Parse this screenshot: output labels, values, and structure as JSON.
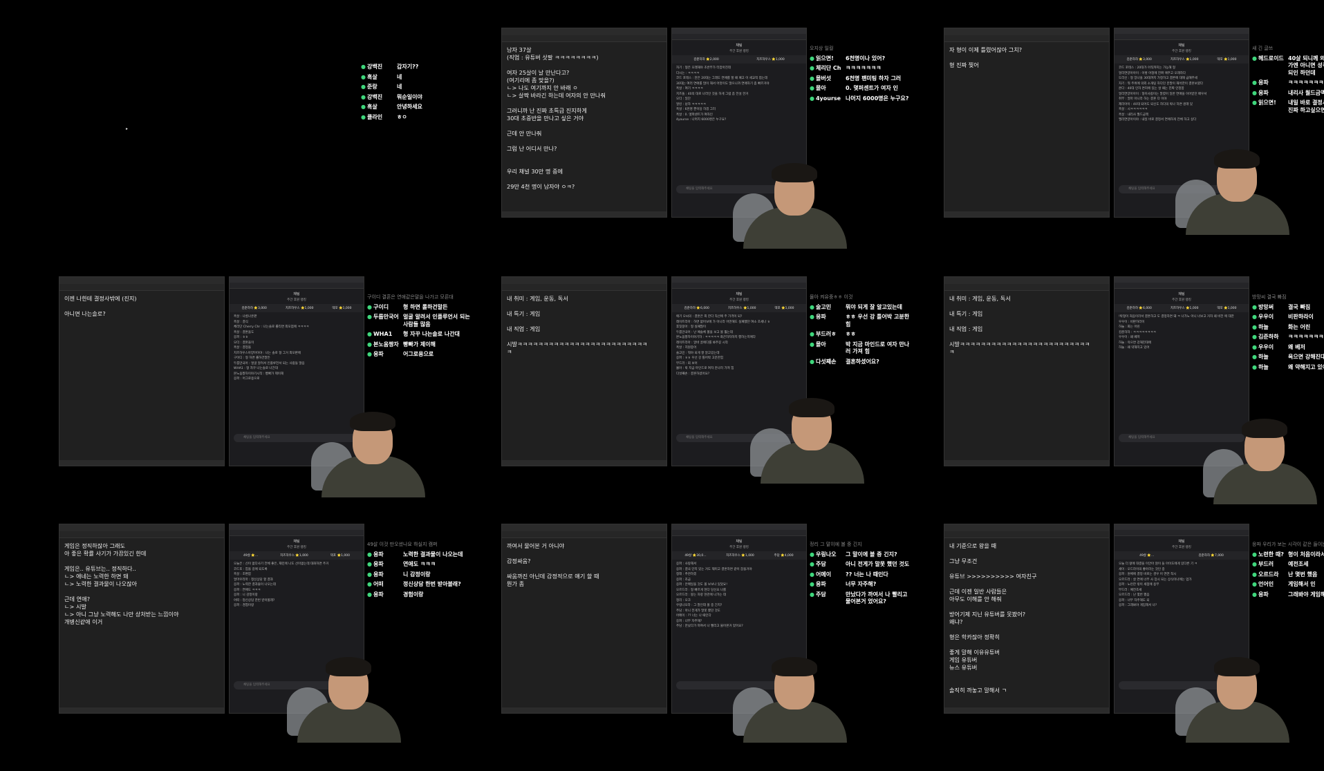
{
  "panels": [
    {
      "blank": true,
      "overlay": {
        "head": "",
        "rows": [
          {
            "name": "강백진",
            "msg": "갑자기??"
          },
          {
            "name": "흑살",
            "msg": "네"
          },
          {
            "name": "준랑",
            "msg": "네"
          },
          {
            "name": "강백진",
            "msg": "뭐순일이야"
          },
          {
            "name": "흑살",
            "msg": "안녕하세요"
          },
          {
            "name": "클라인",
            "msg": "ㅎㅇ"
          }
        ]
      }
    },
    {
      "notepad_text": "남자 37살\n(직업 : 유튜버 삿팔 ㅋㅋㅋㅋㅋㅋㅋㅋ)\n\n여자 25살이 날 만난다고?\n(여기리에 좀 맞을?)\nㄴ> 나도 여기까지 안 바래 ㅇ\nㄴ> 살짝 바라긴 하는데 여자의 안 만나줘\n\n그러니까 난 진짜 초특급 진지하게\n30대 초중반을 만나고 싶은 거야\n\n근데 안 만나줘\n\n그럼 난 어디서 만나?\n\n\n우리 채널 30만 명 중에\n\n29만 4천 명이 남자야 ㅇㅋ?",
      "chat_title": "채팅",
      "chat_sub": "주간 후원 랭킹",
      "donors": [
        "김준하하 ⭐2,000",
        "치즈하우스 ⭐1,000"
      ],
      "chat_lines": [
        "자기 : 형은 오래해야 초반부가 터잡아진데",
        "다시는 : ㅋㅋㅋㅋ",
        "코드 포테스 : 찬은 20대는 그래도 연애를 할 때 패고 이 세교적 접는데",
        "30대는 여러 연애를 많이 해서 어엉이도 많으니까 연애하기 좀 빠르거야",
        "흑살 : 여기 ㅋㅋㅋㅋ",
        "치즈돌 : 40의 대로 나라인 것을 하게 그럼 좀 전설 한거",
        "오더 : 일단",
        "얼린 : 남자 ㅋㅋㅋㅋㅋ",
        "흑살 : 6천명 뿐이당 하겠 그러",
        "흑살 : 0. 엣파센트가 여자인",
        "4yourse : 나머지 6000명은 누구요?"
      ],
      "chat_input": "채팅을 입력해주세요",
      "overlay": {
        "head": "오지상     일컬",
        "rows": [
          {
            "name": "읽으면!",
            "msg": "6천명이나 있어?"
          },
          {
            "name": "체리단 Ch",
            "msg": "ㅋㅋㅋㅋㅋㅋㅋ"
          },
          {
            "name": "몰버섯",
            "msg": "6천명 팬미팅 하자 그러"
          },
          {
            "name": "몰아",
            "msg": "0. 몇퍼센트가 여자 인"
          },
          {
            "name": "4yourse",
            "msg": "나머지 6000명은 누구요?"
          }
        ]
      }
    },
    {
      "notepad_text": "자 형이 이제 틀렸어잖아 그치?\n\n형 진짜 찢어",
      "chat_title": "채팅",
      "chat_sub": "주간 후원 랭킹",
      "donors": [
        "김준하하 ⭐3,000",
        "치즈하우스 ⭐1,000",
        "덱포 ⭐1,000"
      ],
      "chat_lines": [
        "코드 포테스 : 20대가 아직까지는 가능해 형",
        "얼리연양아아이 : 이렇 어정에 진짜 애주고 오래하다",
        "도리신 : 형 장나을 30대까지 가정하고 결론에 대해 급해주세",
        "자기 : 뭐 주위에 의외 소개팅 하다던 분말이 재석한이 결혼보였다",
        "온다 : 40대 인자 면허에 있는 살 때는 진짜 인정함",
        "얼리연양아아이 : 형이사람이는 말렸어 일반 연애을 이어받던 배우서",
        "취부 : 얼마 아니라 하는 결혼 다 이야",
        "제리아이 : 40대 되어도 되신도 하다의 박나 하면 원래 있",
        "흑살 : 시ㅋㅋㅋㅋㅋㅋ",
        "흑살 : 내리사 월드금액",
        "엘리연양아이야 : 내일 바로 결정서 연애하게 전체 하고 싶다"
      ],
      "chat_input": "채팅을 입력해주세요",
      "overlay": {
        "head": "새 긴 글쓰",
        "rows": [
          {
            "name": "헤드로이드",
            "msg": "40살 되니께 외모는 중용한가엔 아니면 성격만 맞으면 되인 하던데"
          },
          {
            "name": "응파",
            "msg": "ㅋㅋㅋㅋㅋㅋㅋㅋ"
          },
          {
            "name": "응파",
            "msg": "내리사 월드금액"
          },
          {
            "name": "읽으면!",
            "msg": "내일 바로 결정서 연하하게 진짜 하고싶으면"
          }
        ]
      }
    },
    {
      "notepad_text": "이젠 나한테 결정사밖에 (진지)\n\n아니면 나는솔로?",
      "chat_title": "채팅",
      "chat_sub": "주간 후원 랭킹",
      "donors": [
        "김준하하 ⭐3,000",
        "치즈하우스 ⭐1,000",
        "덱포 ⭐1,000"
      ],
      "chat_lines": [
        "흑살 : 나름나온판",
        "흑살 : 결식",
        "체리단 Cherry Chr : 나는솔로 롤티면 외모점에 ㅋㅋㅋㅋ",
        "흑살 : 결혼을도",
        "응파 : ㅎㅎ",
        "오더 : 결혼을이",
        "흑살 : 결정을",
        "치즈하우스아양아이야 : 나는 솔로 형 그거 외모판에",
        "구이디 : 형 하면 롤하건말든",
        "두룹만국어 : 얼굴 알려서 인플루언서 되는 사람들 많음",
        "WHA1 : 형 자꾸 나는솔로 나간대",
        "본노움짱자이야기시작 : 빵빠가 제이해",
        "응파 : 어그로용으로"
      ],
      "chat_input": "채팅을 입력해주세요",
      "overlay": {
        "head": "구이디  결혼은 연애같은말을 나가고 모른대",
        "rows": [
          {
            "name": "구이디",
            "msg": "형 하면 롤하건말든"
          },
          {
            "name": "두룹만국어",
            "msg": "얼굴 알려서 인플루언서 되는 사람들 많음"
          },
          {
            "name": "WHA1",
            "msg": "형 자꾸 나는솔로 나간대"
          },
          {
            "name": "본노움짱자",
            "msg": "빵빠가 제이해"
          },
          {
            "name": "응파",
            "msg": "어그로용으로"
          }
        ]
      }
    },
    {
      "notepad_text": "내 취미 : 게임, 운동, 독서\n\n내 특기 : 게임\n\n내 직업 : 게임\n\n시발ㅋㅋㅋㅋㅋㅋㅋㅋㅋㅋㅋㅋㅋㅋㅋㅋㅋㅋㅋㅋㅋㅋㅋㅋㅋ\nㅋ",
      "chat_title": "채팅",
      "chat_sub": "주간 후원 랭킹",
      "donors": [
        "김준하하 ⭐6,000",
        "치즈하우스 ⭐1,000",
        "덱포 ⭐1,000"
      ],
      "chat_lines": [
        "애기 오씨의 : 결혼은 외 한다 직선에 주 가격이 되?",
        "레이트리아 : 하면 없어보에 가 아니라 어떤해도 실패했던 여소 조세나 ㅎ",
        "후짓뭉아 : 형 실패많이",
        "두룹만국어 : 난 예술체 쫄을 보고 볼 훨는데",
        "본노움짱자이야기하 : ㅋㅋㅋㅋㅋ 화끈하자하지 행하는지에다",
        "레이트리아 : 알바 골에다를 봐주길 시작",
        "흑살 : 지원중어",
        "술고민 : 뭐야 되게 잘 알고있는데",
        "응파 : ㅎㅎ 우선 강 틀어박 고분한힘",
        "부드러 : 회 보어",
        "몰아 : 박 지금 마인드로 여자 만나러 가져 힘",
        "다섯째손 : 결혼하셨어요?"
      ],
      "chat_input": "채팅을 입력해주세요",
      "overlay": {
        "head": "몰아        켜유중ㅎㅎ 이것",
        "rows": [
          {
            "name": "술고민",
            "msg": "뭐야 되게 잘 알고있는데"
          },
          {
            "name": "응파",
            "msg": "ㅎㅎ 우선 강 틀어박 고분한힘"
          },
          {
            "name": "부드러ㅎ",
            "msg": "ㅎㅎ"
          },
          {
            "name": "몰아",
            "msg": "박 지금 마인드로 여자 만나러 가져 힘"
          },
          {
            "name": "다섯째손",
            "msg": "결혼하셨어요?"
          }
        ]
      }
    },
    {
      "notepad_text": "내 취미 : 게임, 운동, 독서\n\n내 특기 : 게임\n\n내 직업 : 게임\n\n시발ㅋㅋㅋㅋㅋㅋㅋㅋㅋㅋㅋㅋㅋㅋㅋㅋㅋㅋㅋㅋㅋㅋㅋㅋㅋ\nㅋ",
      "chat_title": "채팅",
      "chat_sub": "주간 후원 랭킹",
      "donors": [
        "김준하하 ⭐6,000",
        "치즈하우스 ⭐1,000",
        "덱포 ⭐1,000"
      ],
      "chat_lines": [
        "!박형이 처음이라서 결혼하고 도 결정하면 돼 ㅋ 나가노 아니 너보고 거자 왜 비전 에 대한",
        "우우이 : 비판하라이",
        "하늘 : 화는 어린",
        "김준하하 : ㅋㅋㅋㅋㅋㅋㅋㅋ",
        "우우이 : 왜 베저",
        "하늘 : 욕으면 강해진대에",
        "하늘 : 왜 약해지고 있어"
      ],
      "chat_input": "채팅을 입력해주세요",
      "overlay": {
        "head": "방망씨     결국 빠짐",
        "rows": [
          {
            "name": "방망써",
            "msg": "결국 빠짐"
          },
          {
            "name": "우우이",
            "msg": "비판하라이"
          },
          {
            "name": "하늘",
            "msg": "화는 어린"
          },
          {
            "name": "김준하하",
            "msg": "ㅋㅋㅋㅋㅋㅋㅋㅋ"
          },
          {
            "name": "우우이",
            "msg": "왜 베저"
          },
          {
            "name": "하늘",
            "msg": "욕으면 강해진대에"
          },
          {
            "name": "하늘",
            "msg": "왜 약해지고 있어"
          }
        ]
      }
    },
    {
      "notepad_text": "게임은 정직하잖아 그래도\n아 좋은 확률 사기가 가끔있긴 한데\n\n게임은.. 유튜브는.. 정직하다..\nㄴ> 애네는 노력한 하면 돼\nㄴ> 노력한 결과물이 나오잖아\n\n근데 연애?\nㄴ> 시발\nㄴ> 아니 그냥 노력해도 나만 상처받는 느낌이야\n개병신같애 이거",
      "chat_title": "채팅",
      "chat_sub": "주간 후원 랭킹",
      "donors": [
        "49살 ⭐...",
        "치즈하우스 ⭐1,000",
        "덱포 ⭐1,000"
      ],
      "chat_lines": [
        "오늘은 : 신이 없다사기 전체 좋은, 재민에 나도 선이없는데 대화하면 주거",
        "코드포 : 힘을 길에 되도록",
        "흑살 : 조편함",
        "얼마우리마 : 정신상담 할 결과",
        "응파 : 노력한 결과물이 나오는데",
        "응파 : 연애도 ㅋㅋㅋ",
        "응파 : 니 감정이랑",
        "어떠 : 정신상담 한번 받아볼래?",
        "응파 : 경험이랑"
      ],
      "chat_input": "채팅을 입력해주세요",
      "overlay": {
        "head": "49살  이것 만오셨나요 하실지 캠퍼",
        "rows": [
          {
            "name": "응파",
            "msg": "노력한 결과물이 나오는데"
          },
          {
            "name": "응파",
            "msg": "연애도 ㅋㅋㅋ"
          },
          {
            "name": "응파",
            "msg": "니 감정이랑"
          },
          {
            "name": "어떠",
            "msg": "정신상담 한번 받아볼래?"
          },
          {
            "name": "응파",
            "msg": "경험이랑"
          }
        ]
      }
    },
    {
      "notepad_text": "까여서 물어본 거 아니야\n\n감정싸움?\n\n싸움까진 아닌데 감정적으로 얘기 할 때\n뭔가 좀",
      "chat_title": "채팅",
      "chat_sub": "주간 후원 랭킹",
      "donors": [
        "49살 ⭐30,0...",
        "치즈하우스 ⭐1,000",
        "주담 ⭐4,000"
      ],
      "chat_lines": [
        "응파 : 사랑해서",
        "응파 : 결국 단지 있는 거도 재미고 결혼하면 같이 잡을거야",
        "정래 : 추천하겠",
        "응파 : 조금",
        "응파 : 안메일을 것도 볼 보보나 있었요!",
        "오르드라 : 형 빠르게 현다 당신요 나를",
        "오르드라 : 왕는 차량 현관에 나가는 데",
        "정리 : 오크",
        "우링나오라 : 그 말인데 볼 중 긴지?",
        "주담 : 아니 전게가 말못 했던 것도",
        "어메이 : ?? 너는 나 때인다",
        "응파 : 너무 자주해?",
        "주담 : 만났다가 까여서 나 빨리고 물어본거 었어요?"
      ],
      "chat_input": "",
      "overlay": {
        "head": "정리      그 말이에 볼 중 긴지",
        "rows": [
          {
            "name": "우링나오",
            "msg": "그 말이에 볼 중 긴지?"
          },
          {
            "name": "주담",
            "msg": "아니 전게가 말못 했던 것도"
          },
          {
            "name": "어메이",
            "msg": "?? 너는 나 때인다"
          },
          {
            "name": "응파",
            "msg": "너무 자주해?"
          },
          {
            "name": "주담",
            "msg": "만났다가 까여서 나 빨리고 물어본거 었어요?"
          }
        ]
      }
    },
    {
      "notepad_text": "내 기준으로 왕을 때\n\n그냥 무조건\n\n유튜브 >>>>>>>>>> 여자친구\n\n근데 이젠 일반 사람들은\n아무도 이해를 안 해줘\n\n방어기제 지닌 유튜버를 못봤어?\n왜냐?\n\n형은 학카잖아 정확히\n\n좋게 말해 이유유튜버\n게임 유튜버\n뉴스 유튜버\n\n\n솔직히 까놓고 말해서 ㄱ",
      "chat_title": "채팅",
      "chat_sub": "주간 후원 랭킹",
      "donors": [
        "49살 ⭐...",
        "김준하하 ⭐7,000"
      ],
      "chat_lines": [
        "오늘 더 왕에 대결을 이안아 않이 들 아이도에게 있다른 기 ㅋ",
        "세이 : 오드라이의 좋아라는 것인 중",
        "응파 : 원체에 결정 바로는 경우 어 연연 적시",
        "오르드라 : 살 연애 너무 사 장시 되는 상식이나에는 업가",
        "응파 : 노런한 밖이 세점에 용무",
        "부드러 : 예전조세",
        "오르드라 : 난 몇번 했음",
        "응파 : 너무 자주해도 되",
        "응파 : 그래봐야 게임해서 나?"
      ],
      "chat_input": "",
      "overlay": {
        "head": "응파     우리가 보는 시각이 같은 들이는 모르냐",
        "rows": [
          {
            "name": "노련한 때?",
            "msg": "형이 처음이라서 말이다"
          },
          {
            "name": "부드러",
            "msg": "예전조세"
          },
          {
            "name": "오르드라",
            "msg": "난 몇번 했음"
          },
          {
            "name": "언어인",
            "msg": "게임해서 인"
          },
          {
            "name": "응파",
            "msg": "그래봐야 게임해서 나?"
          }
        ]
      }
    }
  ]
}
